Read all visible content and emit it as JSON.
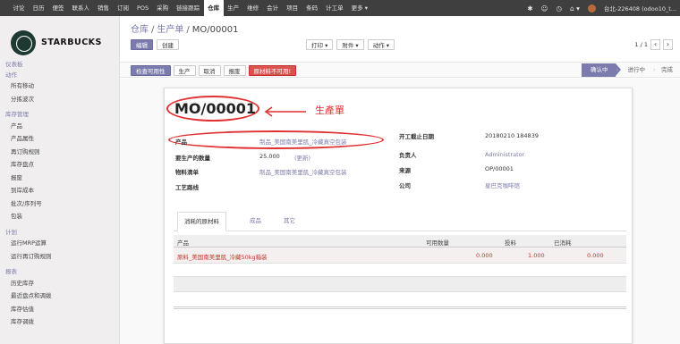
{
  "topbar": {
    "menu": [
      "讨论",
      "日历",
      "便签",
      "联系人",
      "销售",
      "订阅",
      "POS",
      "采购",
      "链接跟踪",
      "仓库",
      "生产",
      "维修",
      "会计",
      "项目",
      "条码",
      "计工单",
      "更多 ▾"
    ],
    "active_index": 9,
    "user": "台北-226408 (odoo10_t..."
  },
  "sidebar": {
    "brand": "STARBUCKS",
    "sections": [
      {
        "title": "仪表板",
        "items": []
      },
      {
        "title": "动作",
        "items": [
          "所有移动",
          "分拣波次"
        ]
      },
      {
        "title": "库存管理",
        "items": [
          "产品",
          "产品属性",
          "再订购规则",
          "库存盘点",
          "报废",
          "到岸成本",
          "批次/序列号",
          "包装"
        ]
      },
      {
        "title": "计划",
        "items": [
          "运行MRP运算",
          "运行再订购规则"
        ]
      },
      {
        "title": "报表",
        "items": [
          "历史库存",
          "最近盘点和调拨",
          "库存估值",
          "库存调拨"
        ]
      }
    ]
  },
  "breadcrumb": {
    "root": "仓库",
    "mid": "生产单",
    "current": "MO/00001"
  },
  "toolbar": {
    "edit": "编辑",
    "create": "创建",
    "print": "打印 ▾",
    "attach": "附件 ▾",
    "action": "动作 ▾"
  },
  "pager": {
    "text": "1 / 1"
  },
  "statusbar": {
    "check_avail": "检查可用性",
    "produce": "生产",
    "cancel": "取消",
    "scrap": "报废",
    "material_warning": "原材料不可用!",
    "stages": [
      "确认中",
      "进行中",
      "完成"
    ]
  },
  "form": {
    "name": "MO/00001",
    "annotation": "生產單",
    "fields_left": [
      {
        "label": "产品",
        "value": "制品_美国南美里肌_冷藏真空包装"
      },
      {
        "label": "要生产的数量",
        "value": "25.000",
        "extra": "(更新)"
      },
      {
        "label": "物料清单",
        "value": "制品_美国南美里肌_冷藏真空包装"
      },
      {
        "label": "工艺路线",
        "value": ""
      }
    ],
    "fields_right": [
      {
        "label": "开工截止日期",
        "value": "20180210 184839"
      },
      {
        "label": "负责人",
        "value": "Administrator"
      },
      {
        "label": "来源",
        "value": "OP/00001"
      },
      {
        "label": "公司",
        "value": "星巴克咖啡馆"
      }
    ]
  },
  "tabs": [
    "消耗的原材料",
    "成品",
    "其它"
  ],
  "table": {
    "headers": [
      "产品",
      "可用数量",
      "投料",
      "已消耗"
    ],
    "rows": [
      {
        "product": "原料_美国南美里肌_冷藏50kg箱装",
        "available": "0.000",
        "to_consume": "1.000",
        "consumed": "0.000"
      }
    ]
  }
}
